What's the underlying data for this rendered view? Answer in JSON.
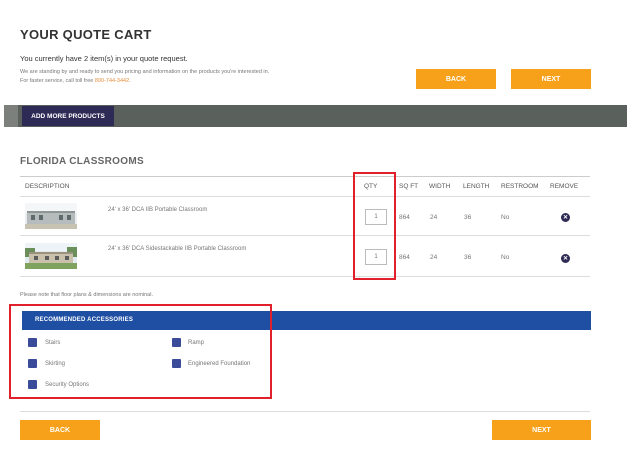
{
  "header": {
    "title": "YOUR QUOTE CART",
    "count_prefix": "You currently have ",
    "count_value": "2",
    "count_suffix": " item(s) in your quote request.",
    "standby_text": "We are standing by and ready to send you pricing and information on the products you're interested in.",
    "tollfree_prefix": "For faster service, call toll free ",
    "tollfree_number": "800-744-3442",
    "tollfree_suffix": "."
  },
  "top_buttons": {
    "back_label": "BACK",
    "next_label": "NEXT"
  },
  "toolbar": {
    "add_more_label": "ADD MORE PRODUCTS"
  },
  "section": {
    "title": "FLORIDA CLASSROOMS"
  },
  "table": {
    "headers": {
      "description": "DESCRIPTION",
      "qty": "QTY",
      "sqft": "SQ FT",
      "width": "WIDTH",
      "length": "LENGTH",
      "restroom": "RESTROOM",
      "remove": "REMOVE"
    },
    "rows": [
      {
        "name": "24' x 36' DCA IIB Portable Classroom",
        "qty": "1",
        "sqft": "864",
        "width": "24",
        "length": "36",
        "restroom": "No",
        "remove_icon": "close-icon"
      },
      {
        "name": "24' x 36' DCA Sidestackable IIB Portable Classroom",
        "qty": "1",
        "sqft": "864",
        "width": "24",
        "length": "36",
        "restroom": "No",
        "remove_icon": "close-icon"
      }
    ]
  },
  "note": "Please note that floor plans & dimensions are nominal.",
  "accessories": {
    "title": "RECOMMENDED ACCESSORIES",
    "items": [
      "Stairs",
      "Ramp",
      "Skirting",
      "Engineered Foundation",
      "Security Options"
    ]
  },
  "bottom_buttons": {
    "back_label": "BACK",
    "next_label": "NEXT"
  },
  "colors": {
    "accent_orange": "#f7a11a",
    "navy": "#2d2a55",
    "accessories_blue": "#1e4fa3",
    "highlight_red": "#e0202a"
  }
}
